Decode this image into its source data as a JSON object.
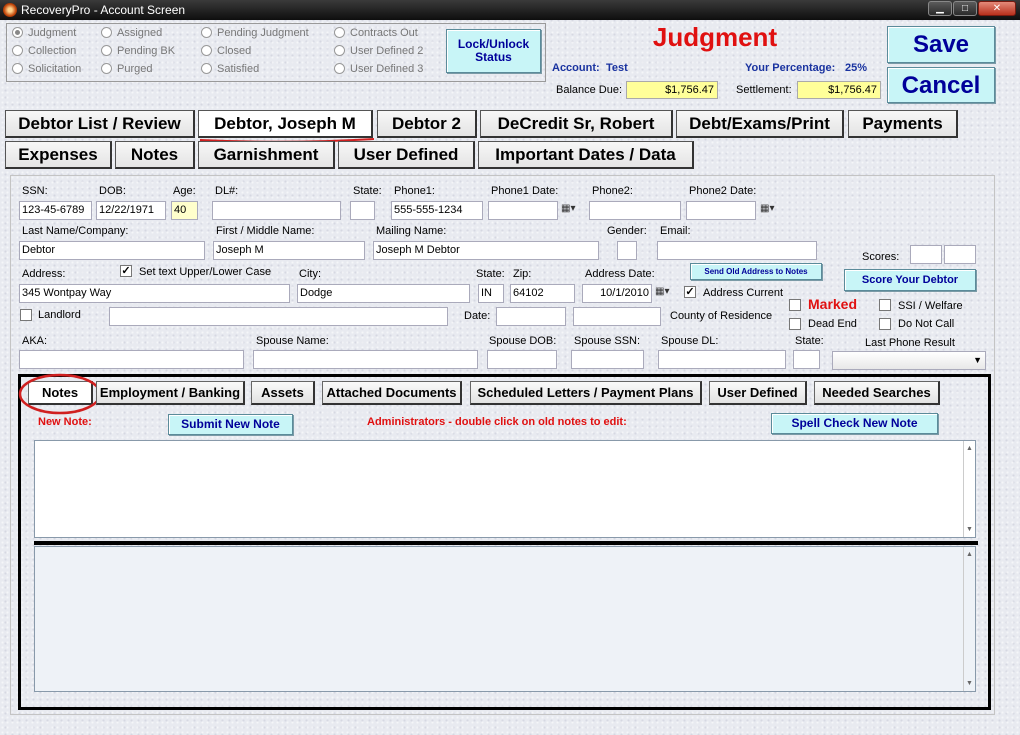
{
  "window": {
    "title": "RecoveryPro - Account Screen",
    "min": "▁",
    "max": "□",
    "close": "✕"
  },
  "status": {
    "options": [
      {
        "label": "Judgment",
        "selected": true
      },
      {
        "label": "Collection",
        "selected": false
      },
      {
        "label": "Solicitation",
        "selected": false
      },
      {
        "label": "Assigned",
        "selected": false
      },
      {
        "label": "Pending BK",
        "selected": false
      },
      {
        "label": "Purged",
        "selected": false
      },
      {
        "label": "Pending Judgment",
        "selected": false
      },
      {
        "label": "Closed",
        "selected": false
      },
      {
        "label": "Satisfied",
        "selected": false
      },
      {
        "label": "Contracts Out",
        "selected": false
      },
      {
        "label": "User Defined 2",
        "selected": false
      },
      {
        "label": "User Defined 3",
        "selected": false
      }
    ],
    "lock_label": "Lock/Unlock Status"
  },
  "header": {
    "title": "Judgment",
    "account_label": "Account:",
    "account_value": "Test",
    "percent_label": "Your Percentage:",
    "percent_value": "25%",
    "balance_label": "Balance Due:",
    "balance_value": "$1,756.47",
    "settlement_label": "Settlement:",
    "settlement_value": "$1,756.47",
    "save_label": "Save",
    "cancel_label": "Cancel"
  },
  "tabs": {
    "row1": [
      "Debtor List / Review",
      "Debtor, Joseph M",
      "Debtor 2",
      "DeCredit Sr, Robert",
      "Debt/Exams/Print",
      "Payments"
    ],
    "row2": [
      "Expenses",
      "Notes",
      "Garnishment",
      "User Defined",
      "Important Dates / Data"
    ],
    "active": "Debtor, Joseph M"
  },
  "form": {
    "ssn_label": "SSN:",
    "ssn": "123-45-6789",
    "dob_label": "DOB:",
    "dob": "12/22/1971",
    "age_label": "Age:",
    "age": "40",
    "dl_label": "DL#:",
    "dl": "",
    "state_label": "State:",
    "state_dl": "",
    "phone1_label": "Phone1:",
    "phone1": "555-555-1234",
    "phone1_date_label": "Phone1 Date:",
    "phone2_label": "Phone2:",
    "phone2_date_label": "Phone2 Date:",
    "last_label": "Last Name/Company:",
    "last": "Debtor",
    "first_label": "First / Middle Name:",
    "first": "Joseph M",
    "mailing_label": "Mailing Name:",
    "mailing": "Joseph M Debtor",
    "gender_label": "Gender:",
    "email_label": "Email:",
    "scores_label": "Scores:",
    "address_label": "Address:",
    "set_text_label": "Set text Upper/Lower Case",
    "address": "345 Wontpay Way",
    "city_label": "City:",
    "city": "Dodge",
    "state2_label": "State:",
    "state2": "IN",
    "zip_label": "Zip:",
    "zip": "64102",
    "address_date_label": "Address Date:",
    "address_date": "10/1/2010",
    "address_current_label": "Address Current",
    "send_old_label": "Send Old Address to Notes",
    "score_debtor_label": "Score Your Debtor",
    "landlord_label": "Landlord",
    "date_label": "Date:",
    "county_label": "County of Residence",
    "marked_label": "Marked",
    "dead_end_label": "Dead End",
    "ssi_label": "SSI / Welfare",
    "do_not_call_label": "Do Not Call",
    "aka_label": "AKA:",
    "spouse_name_label": "Spouse Name:",
    "spouse_dob_label": "Spouse DOB:",
    "spouse_ssn_label": "Spouse SSN:",
    "spouse_dl_label": "Spouse DL:",
    "state3_label": "State:",
    "last_phone_label": "Last Phone Result"
  },
  "subtabs": [
    "Notes",
    "Employment / Banking",
    "Assets",
    "Attached Documents",
    "Scheduled Letters  /  Payment Plans",
    "User Defined",
    "Needed Searches"
  ],
  "notes": {
    "new_note_label": "New Note:",
    "submit_label": "Submit New Note",
    "admin_label": "Administrators - double click on old notes to edit:",
    "spell_label": "Spell Check New Note"
  },
  "colors": {
    "accent_red": "#e01010",
    "navy": "#1a33a0",
    "button_bg": "#c8f5f7",
    "highlight": "#ffff99"
  }
}
